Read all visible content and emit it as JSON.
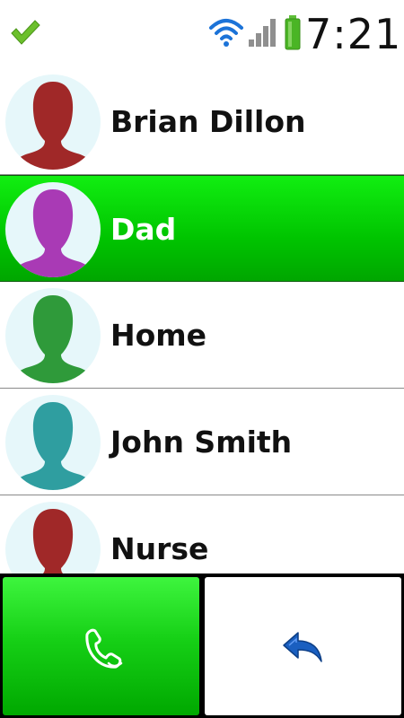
{
  "status_bar": {
    "time": "7:21",
    "icons": [
      "check-icon",
      "wifi-icon",
      "signal-icon",
      "battery-icon"
    ]
  },
  "contacts": [
    {
      "name": "Brian Dillon",
      "avatar_color": "#a02828",
      "selected": false
    },
    {
      "name": "Dad",
      "avatar_color": "#a93ab5",
      "selected": true
    },
    {
      "name": "Home",
      "avatar_color": "#2f9a3a",
      "selected": false
    },
    {
      "name": "John Smith",
      "avatar_color": "#2f9ea0",
      "selected": false
    },
    {
      "name": "Nurse",
      "avatar_color": "#a02828",
      "selected": false
    }
  ],
  "actions": {
    "call_icon": "phone-icon",
    "back_icon": "back-arrow-icon"
  },
  "colors": {
    "selected_row": "#00c400",
    "call_button": "#16d016",
    "avatar_background": "#e6f7fa"
  }
}
